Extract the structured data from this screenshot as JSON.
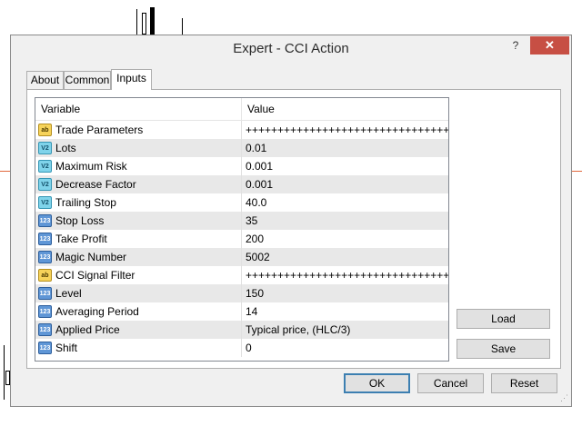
{
  "window": {
    "title": "Expert - CCI Action",
    "minimize_glyph": "?",
    "close_glyph": "✕"
  },
  "tabs": [
    {
      "label": "About",
      "active": false
    },
    {
      "label": "Common",
      "active": false
    },
    {
      "label": "Inputs",
      "active": true
    }
  ],
  "table": {
    "columns": [
      "Variable",
      "Value"
    ],
    "rows": [
      {
        "icon": "ab",
        "icon_text": "ab",
        "name": "Trade Parameters",
        "value": "++++++++++++++++++++++++++++++++++"
      },
      {
        "icon": "double",
        "icon_text": "V2",
        "name": "Lots",
        "value": "0.01"
      },
      {
        "icon": "double",
        "icon_text": "V2",
        "name": "Maximum Risk",
        "value": "0.001"
      },
      {
        "icon": "double",
        "icon_text": "V2",
        "name": "Decrease Factor",
        "value": "0.001"
      },
      {
        "icon": "double",
        "icon_text": "V2",
        "name": "Trailing Stop",
        "value": "40.0"
      },
      {
        "icon": "int",
        "icon_text": "123",
        "name": "Stop Loss",
        "value": "35"
      },
      {
        "icon": "int",
        "icon_text": "123",
        "name": "Take Profit",
        "value": "200"
      },
      {
        "icon": "int",
        "icon_text": "123",
        "name": "Magic Number",
        "value": "5002"
      },
      {
        "icon": "ab",
        "icon_text": "ab",
        "name": "CCI Signal Filter",
        "value": "++++++++++++++++++++++++++++++++++"
      },
      {
        "icon": "int",
        "icon_text": "123",
        "name": "Level",
        "value": "150"
      },
      {
        "icon": "int",
        "icon_text": "123",
        "name": "Averaging Period",
        "value": "14"
      },
      {
        "icon": "int",
        "icon_text": "123",
        "name": "Applied Price",
        "value": "Typical price, (HLC/3)"
      },
      {
        "icon": "int",
        "icon_text": "123",
        "name": "Shift",
        "value": "0"
      }
    ]
  },
  "side_buttons": {
    "load": "Load",
    "save": "Save"
  },
  "footer_buttons": {
    "ok": "OK",
    "cancel": "Cancel",
    "reset": "Reset"
  }
}
